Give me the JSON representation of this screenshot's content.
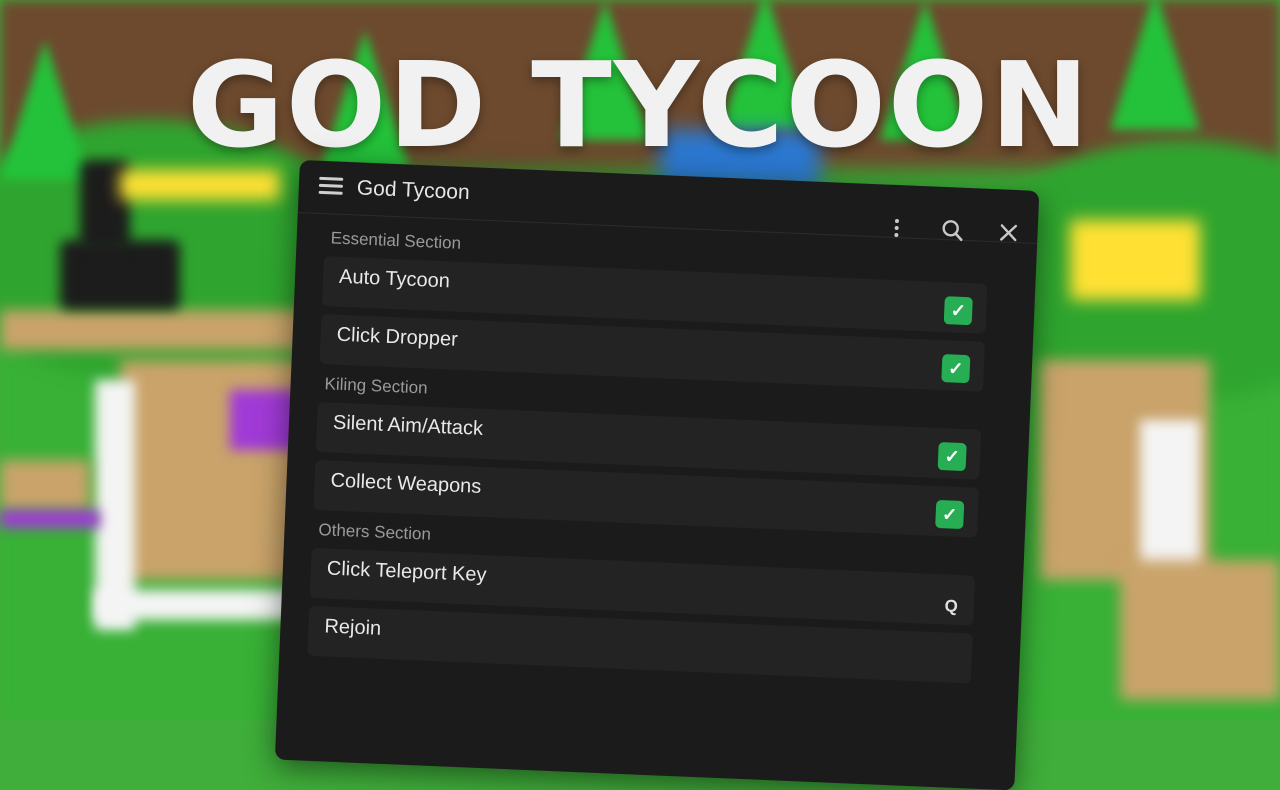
{
  "banner": {
    "title": "GOD TYCOON"
  },
  "window": {
    "title": "God Tycoon",
    "icons": {
      "menu": "hamburger-menu-icon",
      "more": "more-vertical-icon",
      "search": "search-icon",
      "close": "close-icon"
    }
  },
  "sections": [
    {
      "label": "Essential Section",
      "items": [
        {
          "label": "Auto Tycoon",
          "type": "toggle",
          "checked": true
        },
        {
          "label": "Click Dropper",
          "type": "toggle",
          "checked": true
        }
      ]
    },
    {
      "label": "Kiling Section",
      "items": [
        {
          "label": "Silent Aim/Attack",
          "type": "toggle",
          "checked": true
        },
        {
          "label": "Collect Weapons",
          "type": "toggle",
          "checked": true
        }
      ]
    },
    {
      "label": "Others Section",
      "items": [
        {
          "label": "Click Teleport Key",
          "type": "keybind",
          "key": "Q"
        },
        {
          "label": "Rejoin",
          "type": "button"
        }
      ]
    }
  ],
  "colors": {
    "window_bg": "#1b1b1b",
    "row_bg": "#232323",
    "toggle_on": "#27ae54",
    "title_text": "#f1f1f1"
  }
}
